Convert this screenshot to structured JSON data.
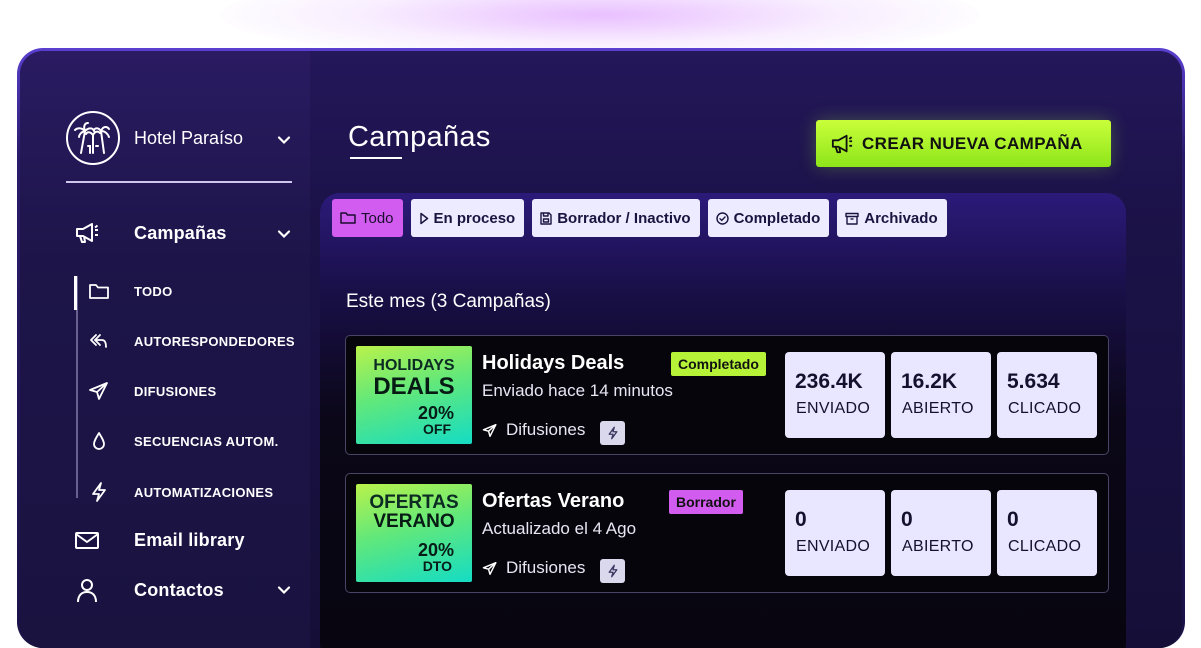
{
  "hotel": {
    "name": "Hotel Paraíso",
    "logo_icon": "palm-trees-logo-icon"
  },
  "sidebar": {
    "campaigns_label": "Campañas",
    "subitems": [
      {
        "label": "TODO",
        "icon": "folder-icon"
      },
      {
        "label": "AUTORESPONDEDORES",
        "icon": "reply-all-icon"
      },
      {
        "label": "DIFUSIONES",
        "icon": "send-icon"
      },
      {
        "label": "SECUENCIAS AUTOM.",
        "icon": "drop-icon"
      },
      {
        "label": "AUTOMATIZACIONES",
        "icon": "bolt-icon"
      }
    ],
    "email_library_label": "Email library",
    "contacts_label": "Contactos"
  },
  "page": {
    "title": "Campañas",
    "create_button": "CREAR NUEVA CAMPAÑA"
  },
  "filters": [
    "Todo",
    "En proceso",
    "Borrador / Inactivo",
    "Completado",
    "Archivado"
  ],
  "section_title": "Este mes (3 Campañas)",
  "campaigns": [
    {
      "thumb_line1": "HOLIDAYS",
      "thumb_line2": "DEALS",
      "thumb_pct": "20%",
      "thumb_suffix": "OFF",
      "title": "Holidays Deals",
      "subtitle": "Enviado hace 14 minutos",
      "type": "Difusiones",
      "status": "Completado",
      "status_color": "#b6f238",
      "stats": [
        {
          "value": "236.4K",
          "label": "ENVIADO"
        },
        {
          "value": "16.2K",
          "label": "ABIERTO"
        },
        {
          "value": "5.634",
          "label": "CLICADO"
        }
      ]
    },
    {
      "thumb_line1": "OFERTAS",
      "thumb_line2": "VERANO",
      "thumb_pct": "20%",
      "thumb_suffix": "DTO",
      "title": "Ofertas Verano",
      "subtitle": "Actualizado el 4 Ago",
      "type": "Difusiones",
      "status": "Borrador",
      "status_color": "#d35cf0",
      "stats": [
        {
          "value": "0",
          "label": "ENVIADO"
        },
        {
          "value": "0",
          "label": "ABIERTO"
        },
        {
          "value": "0",
          "label": "CLICADO"
        }
      ]
    }
  ],
  "colors": {
    "accent_green": "#b6f238",
    "accent_purple": "#d35cf0",
    "background_dark": "#17113d"
  }
}
